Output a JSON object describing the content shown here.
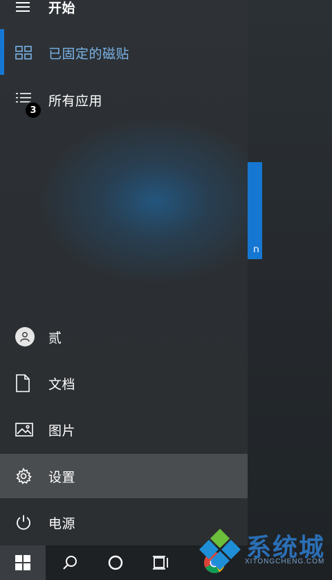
{
  "start_menu": {
    "header_title": "开始",
    "items": [
      {
        "label": "已固定的磁贴",
        "icon": "tiles-icon",
        "active": true
      },
      {
        "label": "所有应用",
        "icon": "list-icon",
        "badge": "3"
      }
    ],
    "bottom_items": [
      {
        "label": "贰",
        "icon": "user-avatar"
      },
      {
        "label": "文档",
        "icon": "document-icon"
      },
      {
        "label": "图片",
        "icon": "pictures-icon"
      },
      {
        "label": "设置",
        "icon": "gear-icon",
        "hover": true
      },
      {
        "label": "电源",
        "icon": "power-icon"
      }
    ]
  },
  "watermark": {
    "text": "系统城",
    "subtext": "XITONGCHENG.COM"
  },
  "colors": {
    "accent": "#1677d2",
    "active_text": "#7ab3e6",
    "hover_bg": "#4a4d50"
  }
}
